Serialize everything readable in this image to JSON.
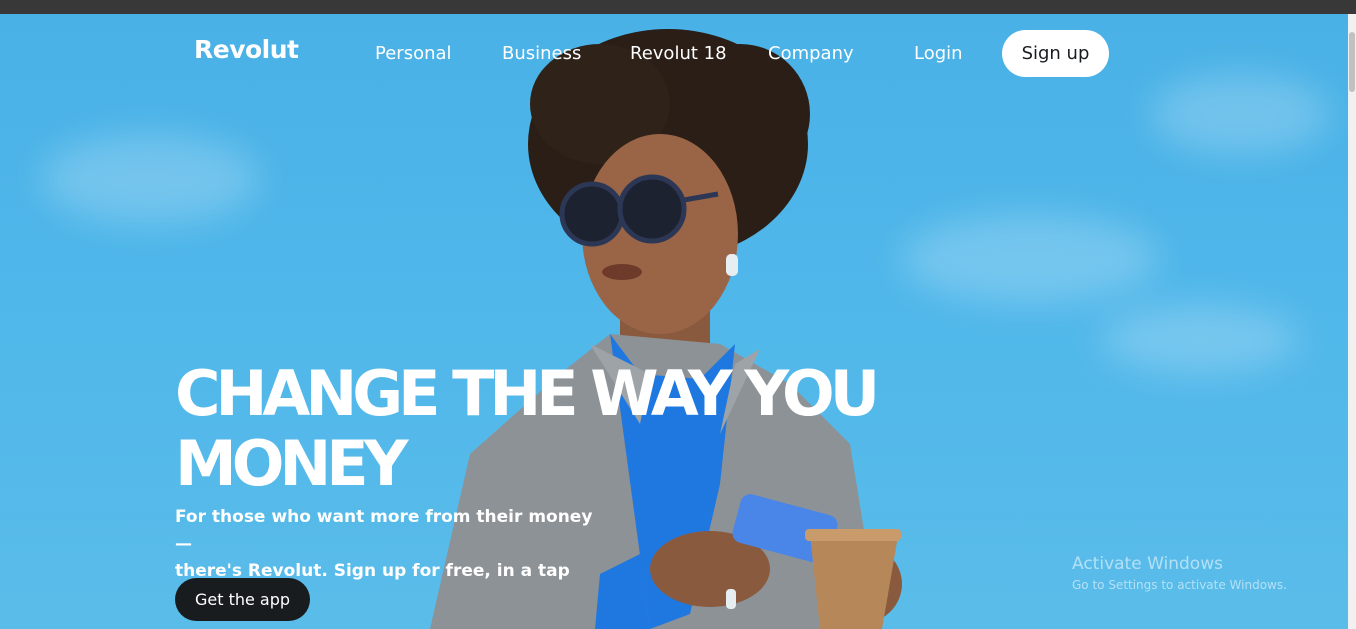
{
  "brand": {
    "logo": "Revolut"
  },
  "nav": {
    "items": [
      {
        "label": "Personal"
      },
      {
        "label": "Business"
      },
      {
        "label": "Revolut 18"
      },
      {
        "label": "Company"
      },
      {
        "label": "Login"
      }
    ],
    "signup_label": "Sign up"
  },
  "hero": {
    "headline_line1": "CHANGE THE WAY YOU",
    "headline_line2": "MONEY",
    "subtext_line1": "For those who want more from their money —",
    "subtext_line2": "there's Revolut. Sign up for free, in a tap",
    "cta_label": "Get the app"
  },
  "watermark": {
    "title": "Activate Windows",
    "subtitle": "Go to Settings to activate Windows."
  },
  "colors": {
    "sky": "#4fb7ea",
    "button_dark": "#191c1f",
    "jacket": "#8d9296",
    "sweater": "#1f78e0"
  }
}
